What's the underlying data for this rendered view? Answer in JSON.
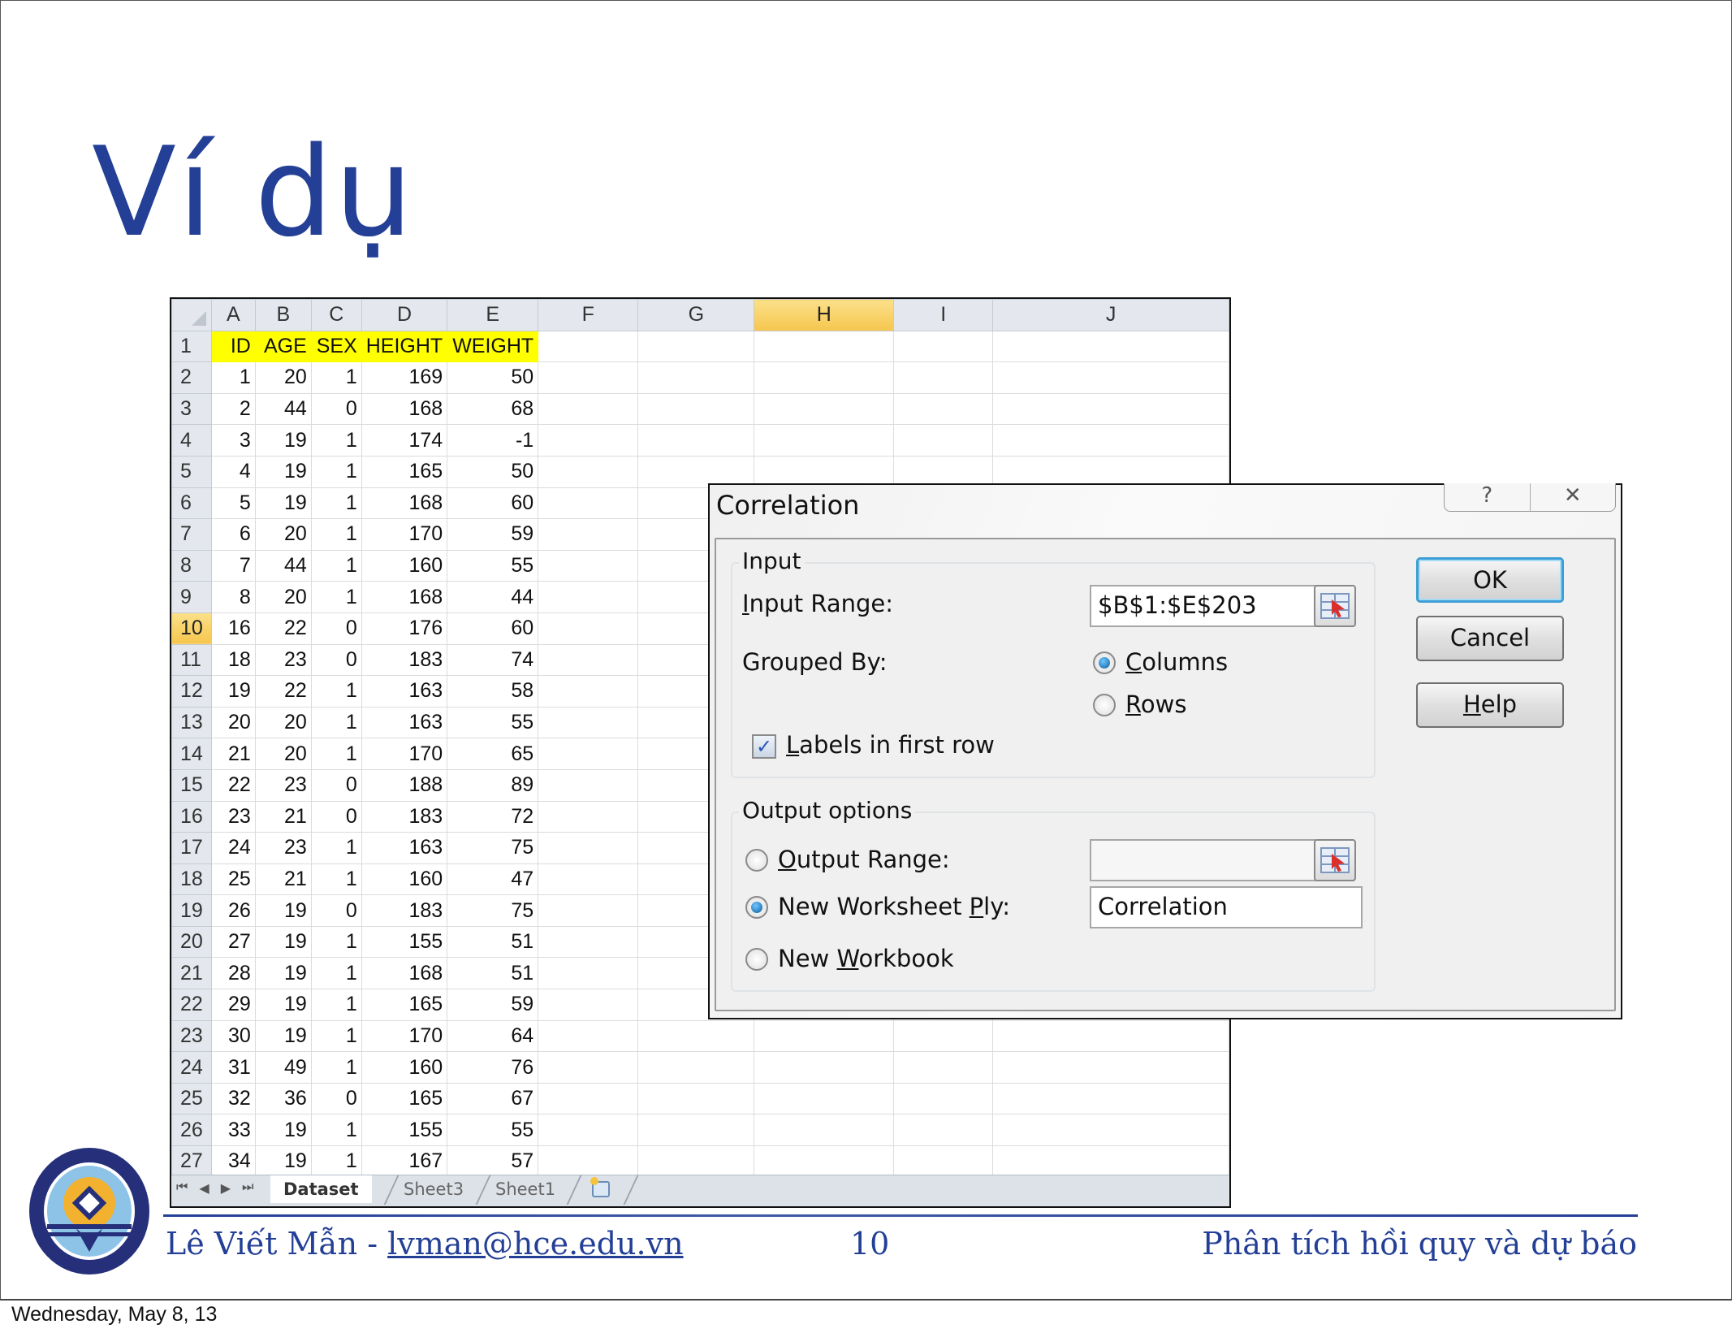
{
  "slide": {
    "title": "Ví dụ",
    "footer": {
      "author": "Lê Viết Mẫn - ",
      "email": "lvman@hce.edu.vn",
      "page_number": "10",
      "course_title": "Phân tích hồi quy và dự báo"
    },
    "date": "Wednesday, May 8, 13",
    "logo": "hue-college-of-economics-logo"
  },
  "spreadsheet": {
    "column_headers": [
      "A",
      "B",
      "C",
      "D",
      "E",
      "F",
      "G",
      "H",
      "I",
      "J"
    ],
    "selected_column": "H",
    "selected_row": "10",
    "header_row": [
      "ID",
      "AGE",
      "SEX",
      "HEIGHT",
      "WEIGHT"
    ],
    "highlight_color": "#ffff00",
    "rows": [
      [
        "1",
        "1",
        "20",
        "1",
        "169",
        "50"
      ],
      [
        "2",
        "2",
        "44",
        "0",
        "168",
        "68"
      ],
      [
        "3",
        "3",
        "19",
        "1",
        "174",
        "-1"
      ],
      [
        "4",
        "4",
        "19",
        "1",
        "165",
        "50"
      ],
      [
        "5",
        "5",
        "19",
        "1",
        "168",
        "60"
      ],
      [
        "6",
        "6",
        "20",
        "1",
        "170",
        "59"
      ],
      [
        "7",
        "7",
        "44",
        "1",
        "160",
        "55"
      ],
      [
        "8",
        "8",
        "20",
        "1",
        "168",
        "44"
      ],
      [
        "9",
        "16",
        "22",
        "0",
        "176",
        "60"
      ],
      [
        "10",
        "18",
        "23",
        "0",
        "183",
        "74"
      ],
      [
        "11",
        "19",
        "22",
        "1",
        "163",
        "58"
      ],
      [
        "12",
        "20",
        "20",
        "1",
        "163",
        "55"
      ],
      [
        "13",
        "21",
        "20",
        "1",
        "170",
        "65"
      ],
      [
        "14",
        "22",
        "23",
        "0",
        "188",
        "89"
      ],
      [
        "15",
        "23",
        "21",
        "0",
        "183",
        "72"
      ],
      [
        "16",
        "24",
        "23",
        "1",
        "163",
        "75"
      ],
      [
        "17",
        "25",
        "21",
        "1",
        "160",
        "47"
      ],
      [
        "18",
        "26",
        "19",
        "0",
        "183",
        "75"
      ],
      [
        "19",
        "27",
        "19",
        "1",
        "155",
        "51"
      ],
      [
        "20",
        "28",
        "19",
        "1",
        "168",
        "51"
      ],
      [
        "21",
        "29",
        "19",
        "1",
        "165",
        "59"
      ],
      [
        "22",
        "30",
        "19",
        "1",
        "170",
        "64"
      ],
      [
        "23",
        "31",
        "49",
        "1",
        "160",
        "76"
      ],
      [
        "24",
        "32",
        "36",
        "0",
        "165",
        "67"
      ],
      [
        "25",
        "33",
        "19",
        "1",
        "155",
        "55"
      ],
      [
        "26",
        "34",
        "19",
        "1",
        "167",
        "57"
      ]
    ],
    "sheet_tabs": [
      {
        "label": "Dataset",
        "active": true
      },
      {
        "label": "Sheet3",
        "active": false
      },
      {
        "label": "Sheet1",
        "active": false
      }
    ],
    "tab_nav_icons": [
      "first-sheet-icon",
      "prev-sheet-icon",
      "next-sheet-icon",
      "last-sheet-icon"
    ],
    "insert_sheet_icon": "insert-worksheet-icon"
  },
  "dialog": {
    "title": "Correlation",
    "help_glyph": "?",
    "close_glyph": "✕",
    "input_group": {
      "label": "Input",
      "input_range_label_u": "I",
      "input_range_label_rest": "nput Range:",
      "input_range_value": "$B$1:$E$203",
      "grouped_by_label": "Grouped By:",
      "columns_u": "C",
      "columns_rest": "olumns",
      "rows_u": "R",
      "rows_rest": "ows",
      "grouped_by_selected": "Columns",
      "labels_u": "L",
      "labels_rest": "abels in first row",
      "labels_checked": true
    },
    "output_group": {
      "label": "Output options",
      "output_range_u": "O",
      "output_range_rest": "utput Range:",
      "output_range_value": "",
      "new_ply_pre": "New Worksheet ",
      "new_ply_u": "P",
      "new_ply_rest": "ly:",
      "new_ply_value": "Correlation",
      "new_workbook_pre": "New ",
      "new_workbook_u": "W",
      "new_workbook_rest": "orkbook",
      "selected": "New Worksheet Ply"
    },
    "buttons": {
      "ok": "OK",
      "cancel": "Cancel",
      "help_u": "H",
      "help_rest": "elp"
    }
  }
}
